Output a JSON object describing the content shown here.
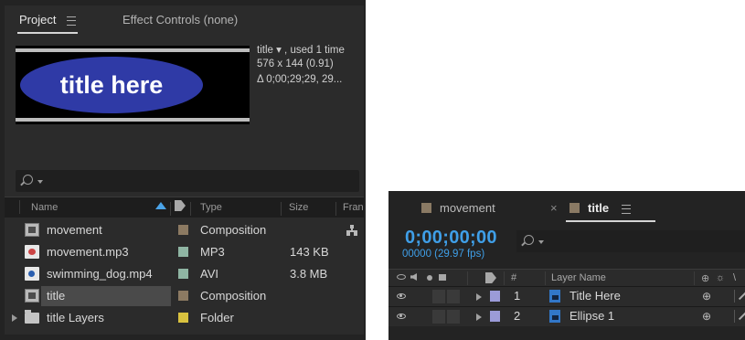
{
  "project_panel": {
    "tab_project": "Project",
    "tab_effect_controls": "Effect Controls (none)",
    "preview": {
      "text": "title here",
      "info_line1": "title ▾ , used 1 time",
      "info_line2": "576 x 144 (0.91)",
      "info_line3": "Δ 0;00;29;29, 29..."
    },
    "columns": {
      "name": "Name",
      "type": "Type",
      "size": "Size",
      "frame": "Fran"
    },
    "items": [
      {
        "name": "movement",
        "type": "Composition",
        "size": "",
        "icon": "composition-icon",
        "label_color": "#8c7a62"
      },
      {
        "name": "movement.mp3",
        "type": "MP3",
        "size": "143 KB",
        "icon": "audio-file-icon",
        "label_color": "#8fb5a3"
      },
      {
        "name": "swimming_dog.mp4",
        "type": "AVI",
        "size": "3.8 MB",
        "icon": "video-file-icon",
        "label_color": "#8fb5a3"
      },
      {
        "name": "title",
        "type": "Composition",
        "size": "",
        "icon": "composition-icon",
        "label_color": "#8c7a62",
        "selected": true
      },
      {
        "name": "title Layers",
        "type": "Folder",
        "size": "",
        "icon": "folder-icon",
        "label_color": "#d9c23f"
      }
    ]
  },
  "timeline_panel": {
    "tabs": [
      {
        "label": "movement",
        "active": false
      },
      {
        "label": "title",
        "active": true
      }
    ],
    "timecode": "0;00;00;00",
    "frame_readout": "00000 (29.97 fps)",
    "columns": {
      "number": "#",
      "layer_name": "Layer Name"
    },
    "layers": [
      {
        "number": "1",
        "name": "Title Here",
        "label_color": "#9b9bd8"
      },
      {
        "number": "2",
        "name": "Ellipse 1",
        "label_color": "#9b9bd8"
      }
    ]
  },
  "colors": {
    "accent_blue": "#3f9fe8",
    "panel_bg": "#2b2b2b",
    "selection": "#4a4a4a"
  }
}
